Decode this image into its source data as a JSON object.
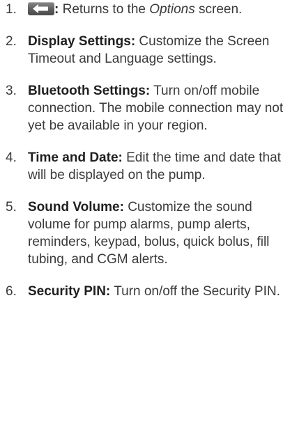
{
  "items": [
    {
      "number": "1.",
      "icon": "back-arrow-icon",
      "colon": ":",
      "text_before": " Returns to the ",
      "emphasis": "Options",
      "text_after": " screen."
    },
    {
      "number": "2.",
      "term": "Display Settings:",
      "description": " Customize the Screen Timeout and Language settings."
    },
    {
      "number": "3.",
      "term": "Bluetooth Settings:",
      "description": " Turn on/off mobile connection. The mobile connection may not yet be available in your region."
    },
    {
      "number": "4.",
      "term": "Time and Date:",
      "description": " Edit the time and date that will be displayed on the pump."
    },
    {
      "number": "5.",
      "term": "Sound Volume:",
      "description": " Customize the sound volume for pump alarms, pump alerts, reminders, keypad, bolus, quick bolus, fill tubing, and CGM alerts."
    },
    {
      "number": "6.",
      "term": "Security PIN:",
      "description": " Turn on/off the Security PIN."
    }
  ]
}
